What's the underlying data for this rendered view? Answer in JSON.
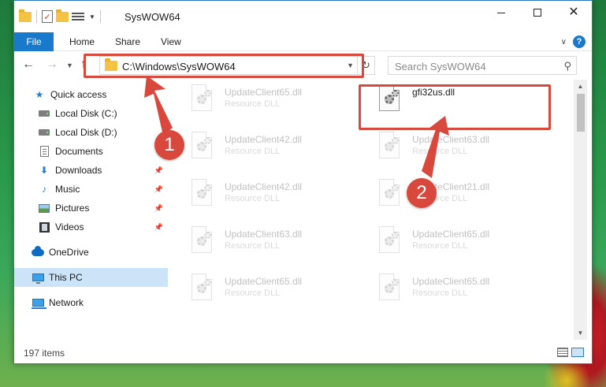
{
  "window": {
    "title": "SysWOW64"
  },
  "ribbon": {
    "tabs": [
      {
        "label": "File"
      },
      {
        "label": "Home"
      },
      {
        "label": "Share"
      },
      {
        "label": "View"
      }
    ]
  },
  "navbar": {
    "address": "C:\\Windows\\SysWOW64",
    "search_placeholder": "Search SysWOW64"
  },
  "sidebar": {
    "items": [
      {
        "label": "Quick access",
        "icon": "star-icon"
      },
      {
        "label": "Local Disk (C:)",
        "icon": "disk-icon"
      },
      {
        "label": "Local Disk (D:)",
        "icon": "disk-icon"
      },
      {
        "label": "Documents",
        "icon": "document-icon"
      },
      {
        "label": "Downloads",
        "icon": "download-icon",
        "pinned": true
      },
      {
        "label": "Music",
        "icon": "music-icon",
        "pinned": true
      },
      {
        "label": "Pictures",
        "icon": "pictures-icon",
        "pinned": true
      },
      {
        "label": "Videos",
        "icon": "videos-icon",
        "pinned": true
      },
      {
        "label": "OneDrive",
        "icon": "cloud-icon"
      },
      {
        "label": "This PC",
        "icon": "computer-icon",
        "selected": true
      },
      {
        "label": "Network",
        "icon": "network-icon"
      }
    ]
  },
  "files": [
    {
      "name": "UpdateClient65.dll",
      "type": "Resource DLL"
    },
    {
      "name": "gfi32us.dll",
      "type": ""
    },
    {
      "name": "UpdateClient42.dll",
      "type": "Resource DLL"
    },
    {
      "name": "UpdateClient63.dll",
      "type": "Resource DLL"
    },
    {
      "name": "UpdateClient42.dll",
      "type": "Resource DLL"
    },
    {
      "name": "UpdateClient21.dll",
      "type": "Resource DLL"
    },
    {
      "name": "UpdateClient63.dll",
      "type": "Resource DLL"
    },
    {
      "name": "UpdateClient65.dll",
      "type": "Resource DLL"
    },
    {
      "name": "UpdateClient65.dll",
      "type": "Resource DLL"
    },
    {
      "name": "UpdateClient65.dll",
      "type": "Resource DLL"
    }
  ],
  "status": {
    "item_count": "197 items"
  },
  "callouts": {
    "step1": "1",
    "step2": "2",
    "color": "#d9483d"
  }
}
